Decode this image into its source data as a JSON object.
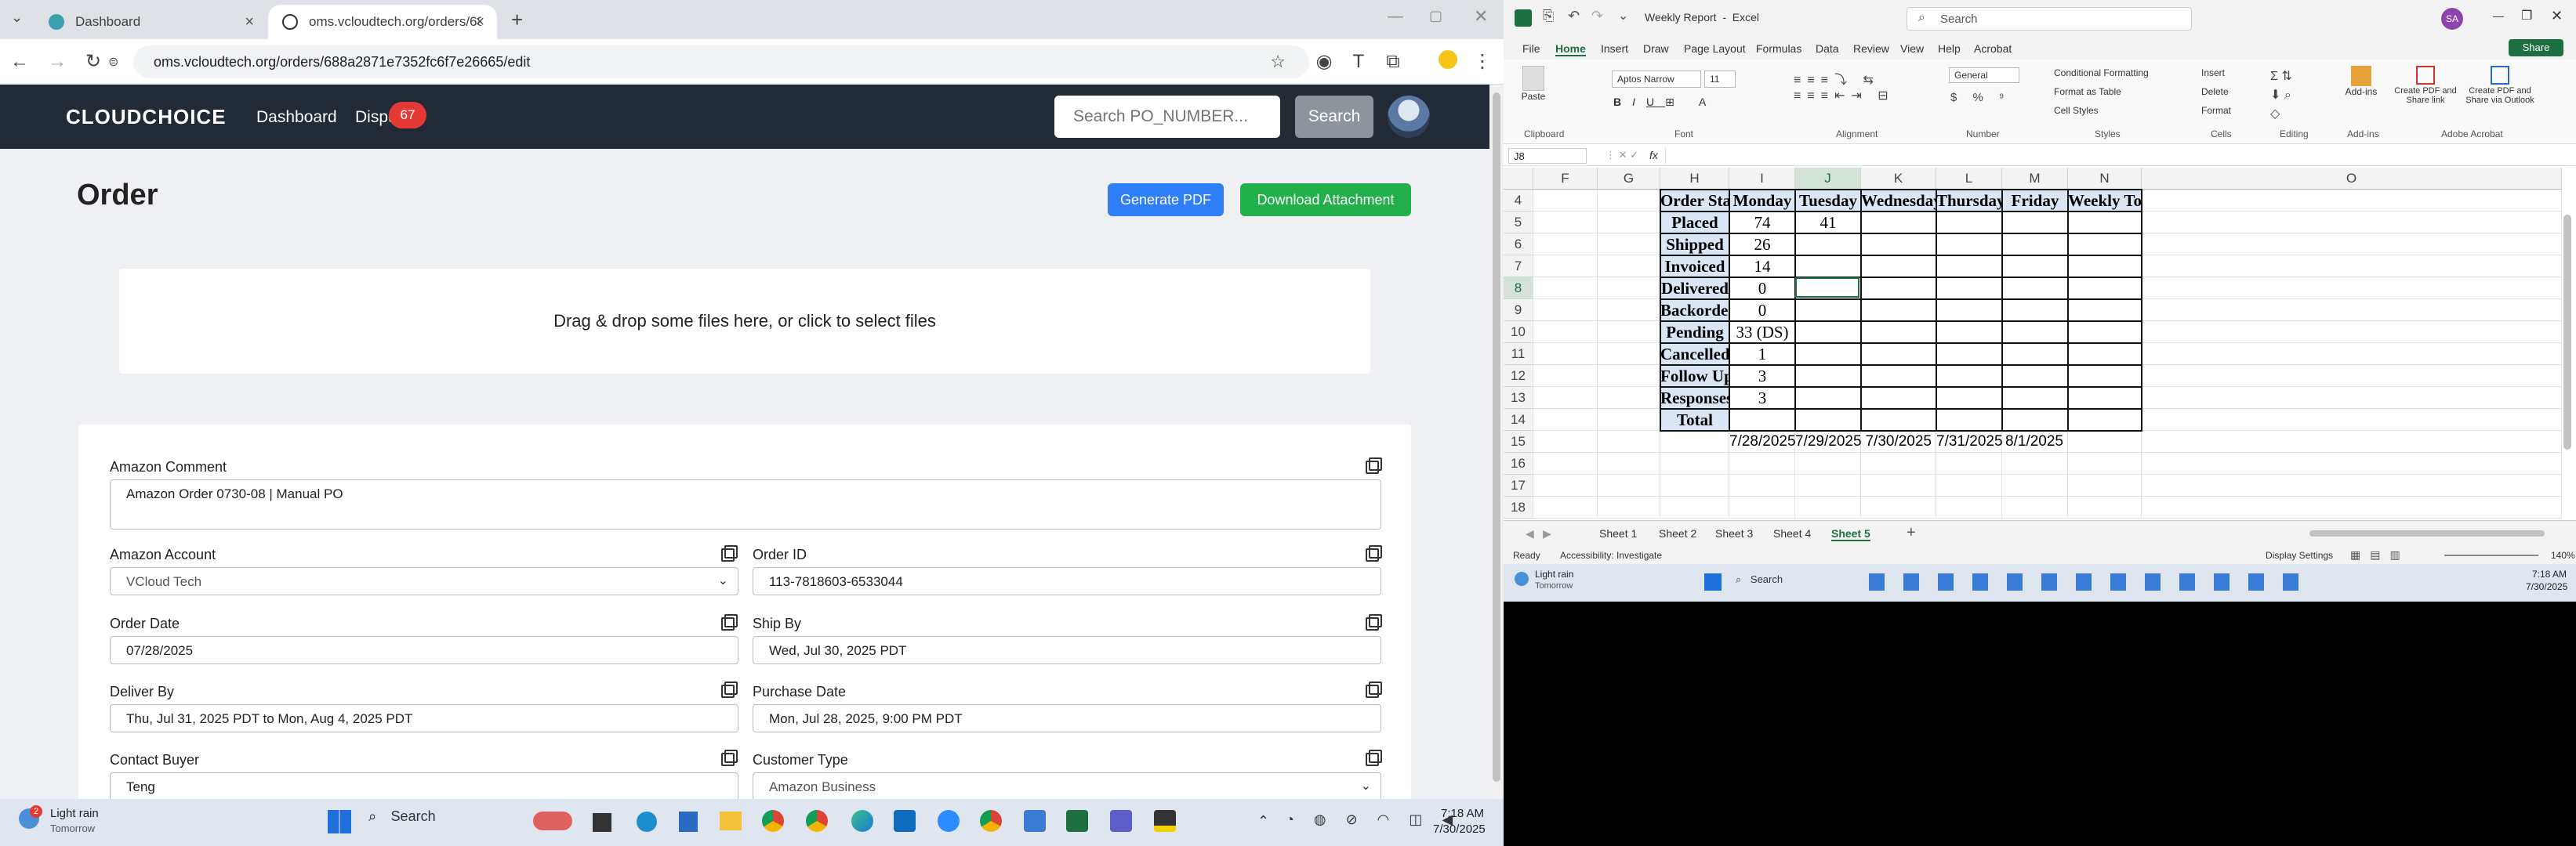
{
  "browser": {
    "tabs": [
      {
        "title": "Dashboard",
        "active": false
      },
      {
        "title": "oms.vcloudtech.org/orders/688",
        "active": true
      }
    ],
    "url": "oms.vcloudtech.org/orders/688a2871e7352fc6f7e26665/edit"
  },
  "site": {
    "logo": "CLOUDCHOICE",
    "nav": [
      "Dashboard",
      "Dispu"
    ],
    "badge": "67",
    "search_placeholder": "Search PO_NUMBER...",
    "search_button": "Search",
    "page_title": "Order",
    "generate_pdf": "Generate PDF",
    "download_attachment": "Download Attachment",
    "dropzone_text": "Drag & drop some files here, or click to select files",
    "fields": {
      "amazon_comment_label": "Amazon Comment",
      "amazon_comment_value": "Amazon Order 0730-08 | Manual PO",
      "amazon_account_label": "Amazon Account",
      "amazon_account_value": "VCloud Tech",
      "order_id_label": "Order ID",
      "order_id_value": "113-7818603-6533044",
      "order_date_label": "Order Date",
      "order_date_value": "07/28/2025",
      "ship_by_label": "Ship By",
      "ship_by_value": "Wed, Jul 30, 2025 PDT",
      "deliver_by_label": "Deliver By",
      "deliver_by_value": "Thu, Jul 31, 2025 PDT to Mon, Aug 4, 2025 PDT",
      "purchase_date_label": "Purchase Date",
      "purchase_date_value": "Mon, Jul 28, 2025, 9:00 PM PDT",
      "contact_buyer_label": "Contact Buyer",
      "contact_buyer_value": "Teng",
      "customer_type_label": "Customer Type",
      "customer_type_value": "Amazon Business"
    }
  },
  "taskbar_left": {
    "weather_title": "Light rain",
    "weather_sub": "Tomorrow",
    "weather_badge": "2",
    "search": "Search",
    "time": "7:18 AM",
    "date": "7/30/2025"
  },
  "excel": {
    "title": "Weekly Report  -  Excel",
    "search": "Search",
    "avatar": "SA",
    "share": "Share",
    "menu": [
      "File",
      "Home",
      "Insert",
      "Draw",
      "Page Layout",
      "Formulas",
      "Data",
      "Review",
      "View",
      "Help",
      "Acrobat"
    ],
    "ribbon": {
      "font": "Aptos Narrow",
      "size": "11",
      "number_format": "General",
      "groups": [
        "Clipboard",
        "Font",
        "Alignment",
        "Number",
        "Styles",
        "Cells",
        "Editing",
        "Add-ins",
        "Adobe Acrobat"
      ],
      "styles": [
        "Conditional Formatting",
        "Format as Table",
        "Cell Styles"
      ],
      "cells": [
        "Insert",
        "Delete",
        "Format"
      ],
      "addins": "Add-ins",
      "acrobat1": "Create PDF and Share link",
      "acrobat2": "Create PDF and Share via Outlook",
      "paste": "Paste"
    },
    "name_box": "J8",
    "fx": "fx",
    "columns": [
      "F",
      "G",
      "H",
      "I",
      "J",
      "K",
      "L",
      "M",
      "N",
      "O"
    ],
    "rows": [
      "4",
      "5",
      "6",
      "7",
      "8",
      "9",
      "10",
      "11",
      "12",
      "13",
      "14",
      "15",
      "16",
      "17",
      "18"
    ],
    "table_header": [
      "Order Status",
      "Monday",
      "Tuesday",
      "Wednesday",
      "Thursday",
      "Friday",
      "Weekly Total"
    ],
    "table_rows": [
      {
        "label": "Placed",
        "mon": "74",
        "tue": "41"
      },
      {
        "label": "Shipped",
        "mon": "26",
        "tue": ""
      },
      {
        "label": "Invoiced",
        "mon": "14",
        "tue": ""
      },
      {
        "label": "Delivered",
        "mon": "0",
        "tue": ""
      },
      {
        "label": "Backordered",
        "mon": "0",
        "tue": ""
      },
      {
        "label": "Pending",
        "mon": "33 (DS)",
        "tue": ""
      },
      {
        "label": "Cancelled",
        "mon": "1",
        "tue": ""
      },
      {
        "label": "Follow Ups",
        "mon": "3",
        "tue": ""
      },
      {
        "label": "Responses",
        "mon": "3",
        "tue": ""
      },
      {
        "label": "Total",
        "mon": "",
        "tue": ""
      }
    ],
    "dates": [
      "7/28/2025",
      "7/29/2025",
      "7/30/2025",
      "7/31/2025",
      "8/1/2025"
    ],
    "sheets": [
      "Sheet 1",
      "Sheet 2",
      "Sheet 3",
      "Sheet 4",
      "Sheet 5"
    ],
    "active_sheet": "Sheet 5",
    "status_ready": "Ready",
    "status_access": "Accessibility: Investigate",
    "display_settings": "Display Settings",
    "zoom": "140%",
    "taskbar": {
      "weather_title": "Light rain",
      "weather_sub": "Tomorrow",
      "search": "Search",
      "time": "7:18 AM",
      "date": "7/30/2025"
    }
  }
}
